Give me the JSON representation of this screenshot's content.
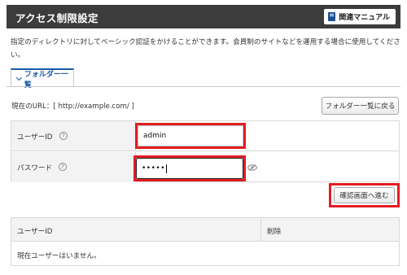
{
  "header": {
    "title": "アクセス制限設定",
    "manual_button": "関連マニュアル"
  },
  "description": "指定のディレクトリに対してベーシック認証をかけることができます。会員制のサイトなどを運用する場合に使用してください。",
  "tab": {
    "label": "フォルダー一覧"
  },
  "current_url": "現在のURL：[ http://example.com/ ]",
  "folder_list_button": "フォルダー一覧に戻る",
  "form": {
    "user_id_label": "ユーザーID",
    "user_id_value": "admin",
    "password_label": "パスワード",
    "password_dots": "•••••",
    "help_glyph": "?"
  },
  "confirm_button": "確認画面へ進む",
  "user_table": {
    "col_user_id": "ユーザーID",
    "col_delete": "削除",
    "empty_message": "現在ユーザーはいません。"
  },
  "colors": {
    "highlight": "#e31c23",
    "header_bg": "#3c3c3c",
    "accent": "#1a5aa6"
  }
}
